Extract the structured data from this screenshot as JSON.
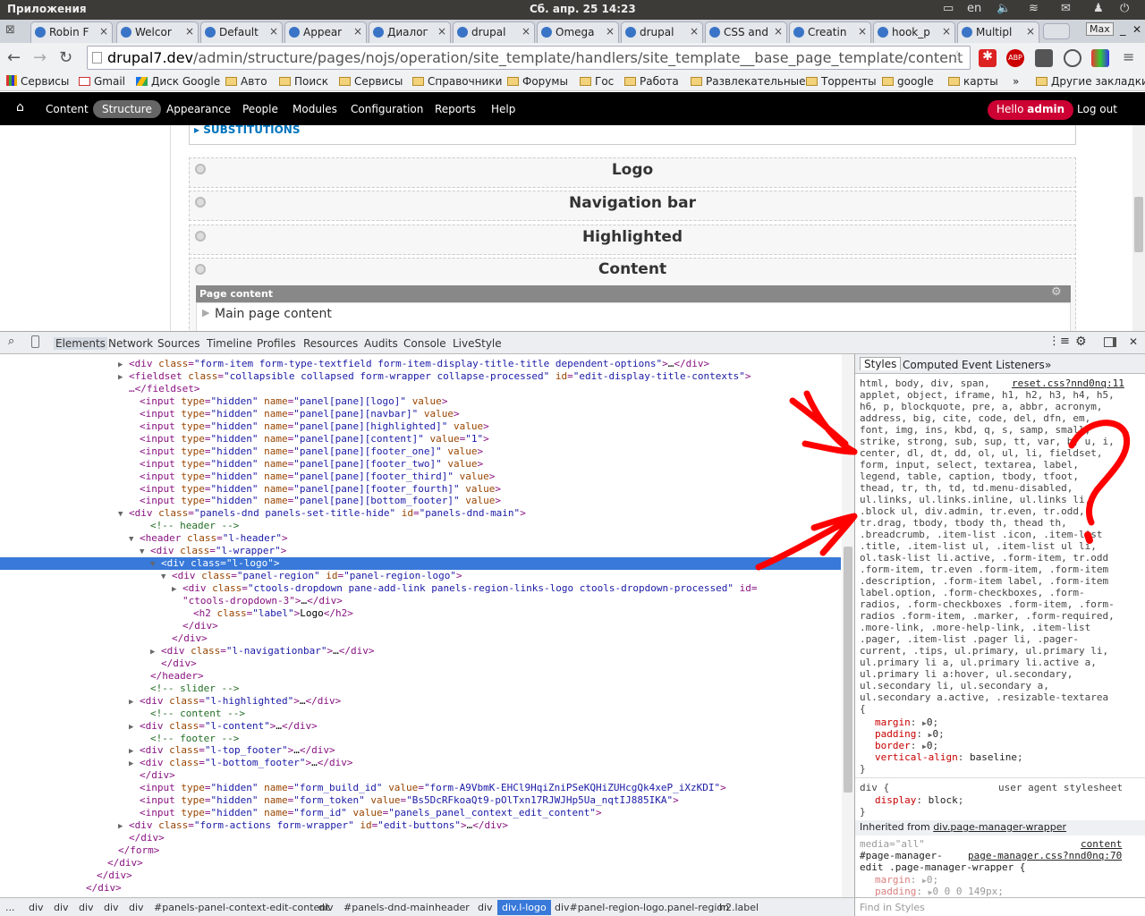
{
  "system": {
    "apps": "Приложения",
    "clock": "Сб. апр. 25 14:23",
    "lang": "en",
    "user": "Max"
  },
  "tabs": [
    "Robin F",
    "Welcor",
    "Default",
    "Appear",
    "Диалог",
    "drupal",
    "Omega",
    "drupal",
    "CSS and",
    "Creatin",
    "hook_p",
    "Multipl"
  ],
  "address": {
    "host": "drupal7.dev",
    "path": "/admin/structure/pages/nojs/operation/site_template/handlers/site_template__base_page_template/content"
  },
  "bookmarks": {
    "apps": "Сервисы",
    "items": [
      "Gmail",
      "Диск Google",
      "Авто",
      "Поиск",
      "Сервисы",
      "Справочники",
      "Форумы",
      "Гос",
      "Работа",
      "Развлекательные",
      "Торренты",
      "google",
      "карты"
    ],
    "more": "»",
    "other": "Другие закладки"
  },
  "admin_menu": {
    "items": [
      "Content",
      "Structure",
      "Appearance",
      "People",
      "Modules",
      "Configuration",
      "Reports",
      "Help"
    ],
    "active": "Structure",
    "hello": "Hello",
    "user": "admin",
    "logout": "Log out"
  },
  "page": {
    "substitutions": "SUBSTITUTIONS",
    "regions": [
      "Logo",
      "Navigation bar",
      "Highlighted",
      "Content"
    ],
    "pane_title": "Page content",
    "pane_item": "Main page content"
  },
  "devtools": {
    "tabs": [
      "Elements",
      "Network",
      "Sources",
      "Timeline",
      "Profiles",
      "Resources",
      "Audits",
      "Console",
      "LiveStyle"
    ],
    "active_tab": "Elements",
    "style_tabs": [
      "Styles",
      "Computed",
      "Event Listeners"
    ],
    "style_more": "»",
    "dom_lines": [
      {
        "i": 12,
        "t": "▶",
        "s": "<div class=\"form-item form-type-textfield form-item-display-title-title dependent-options\">…</div>"
      },
      {
        "i": 12,
        "t": "▶",
        "s": "<fieldset class=\"collapsible collapsed form-wrapper collapse-processed\" id=\"edit-display-title-contexts\">"
      },
      {
        "i": 12,
        "t": "",
        "s": "…</fieldset>"
      },
      {
        "i": 13,
        "t": "",
        "s": "<input type=\"hidden\" name=\"panel[pane][logo]\" value>"
      },
      {
        "i": 13,
        "t": "",
        "s": "<input type=\"hidden\" name=\"panel[pane][navbar]\" value>"
      },
      {
        "i": 13,
        "t": "",
        "s": "<input type=\"hidden\" name=\"panel[pane][highlighted]\" value>"
      },
      {
        "i": 13,
        "t": "",
        "s": "<input type=\"hidden\" name=\"panel[pane][content]\" value=\"1\">"
      },
      {
        "i": 13,
        "t": "",
        "s": "<input type=\"hidden\" name=\"panel[pane][footer_one]\" value>"
      },
      {
        "i": 13,
        "t": "",
        "s": "<input type=\"hidden\" name=\"panel[pane][footer_two]\" value>"
      },
      {
        "i": 13,
        "t": "",
        "s": "<input type=\"hidden\" name=\"panel[pane][footer_third]\" value>"
      },
      {
        "i": 13,
        "t": "",
        "s": "<input type=\"hidden\" name=\"panel[pane][footer_fourth]\" value>"
      },
      {
        "i": 13,
        "t": "",
        "s": "<input type=\"hidden\" name=\"panel[pane][bottom_footer]\" value>"
      },
      {
        "i": 12,
        "t": "▼",
        "s": "<div class=\"panels-dnd panels-set-title-hide\" id=\"panels-dnd-main\">"
      },
      {
        "i": 14,
        "t": "",
        "s": "<!-- header -->"
      },
      {
        "i": 13,
        "t": "▼",
        "s": "<header class=\"l-header\">"
      },
      {
        "i": 14,
        "t": "▼",
        "s": "<div class=\"l-wrapper\">"
      },
      {
        "i": 15,
        "t": "▼",
        "s": "<div class=\"l-logo\">"
      },
      {
        "i": 16,
        "t": "▼",
        "s": "<div class=\"panel-region\" id=\"panel-region-logo\">"
      },
      {
        "i": 17,
        "t": "▶",
        "s": "<div class=\"ctools-dropdown pane-add-link panels-region-links-logo ctools-dropdown-processed\" id="
      },
      {
        "i": 17,
        "t": "",
        "s": "\"ctools-dropdown-3\">…</div>"
      },
      {
        "i": 18,
        "t": "",
        "s": "<h2 class=\"label\">Logo</h2>"
      },
      {
        "i": 17,
        "t": "",
        "s": "</div>"
      },
      {
        "i": 16,
        "t": "",
        "s": "</div>"
      },
      {
        "i": 15,
        "t": "▶",
        "s": "<div class=\"l-navigationbar\">…</div>"
      },
      {
        "i": 15,
        "t": "",
        "s": "</div>"
      },
      {
        "i": 14,
        "t": "",
        "s": "</header>"
      },
      {
        "i": 14,
        "t": "",
        "s": "<!-- slider -->"
      },
      {
        "i": 13,
        "t": "▶",
        "s": "<div class=\"l-highlighted\">…</div>"
      },
      {
        "i": 14,
        "t": "",
        "s": "<!-- content -->"
      },
      {
        "i": 13,
        "t": "▶",
        "s": "<div class=\"l-content\">…</div>"
      },
      {
        "i": 14,
        "t": "",
        "s": "<!-- footer -->"
      },
      {
        "i": 13,
        "t": "▶",
        "s": "<div class=\"l-top_footer\">…</div>"
      },
      {
        "i": 13,
        "t": "▶",
        "s": "<div class=\"l-bottom_footer\">…</div>"
      },
      {
        "i": 13,
        "t": "",
        "s": "</div>"
      },
      {
        "i": 13,
        "t": "",
        "s": "<input type=\"hidden\" name=\"form_build_id\" value=\"form-A9VbmK-EHCl9HqiZniPSeKQHiZUHcgQk4xeP_iXzKDI\">"
      },
      {
        "i": 13,
        "t": "",
        "s": "<input type=\"hidden\" name=\"form_token\" value=\"Bs5DcRFkoaQt9-pOlTxn17RJWJHp5Ua_nqtIJ885IKA\">"
      },
      {
        "i": 13,
        "t": "",
        "s": "<input type=\"hidden\" name=\"form_id\" value=\"panels_panel_context_edit_content\">"
      },
      {
        "i": 12,
        "t": "▶",
        "s": "<div class=\"form-actions form-wrapper\" id=\"edit-buttons\">…</div>"
      },
      {
        "i": 12,
        "t": "",
        "s": "</div>"
      },
      {
        "i": 11,
        "t": "",
        "s": "</form>"
      },
      {
        "i": 10,
        "t": "",
        "s": "</div>"
      },
      {
        "i": 9,
        "t": "",
        "s": "</div>"
      },
      {
        "i": 8,
        "t": "",
        "s": "</div>"
      }
    ],
    "selected_line": 16,
    "reset_selector_lines": [
      "html, body, div, span,",
      "applet, object, iframe, h1, h2, h3, h4, h5,",
      "h6, p, blockquote, pre, a, abbr, acronym,",
      "address, big, cite, code, del, dfn, em,",
      "font, img, ins, kbd, q, s, samp, small,",
      "strike, strong, sub, sup, tt, var, b, u, i,",
      "center, dl, dt, dd, ol, ul, li, fieldset,",
      "form, input, select, textarea, label,",
      "legend, table, caption, tbody, tfoot,",
      "thead, tr, th, td, td.menu-disabled,",
      "ul.links, ul.links.inline, ul.links li,",
      ".block ul, div.admin, tr.even, tr.odd,",
      "tr.drag, tbody, tbody th, thead th,",
      ".breadcrumb, .item-list .icon, .item-list",
      ".title, .item-list ul, .item-list ul li,",
      "ol.task-list li.active, .form-item, tr.odd",
      ".form-item, tr.even .form-item, .form-item",
      ".description, .form-item label, .form-item",
      "label.option, .form-checkboxes, .form-",
      "radios, .form-checkboxes .form-item, .form-",
      "radios .form-item, .marker, .form-required,",
      ".more-link, .more-help-link, .item-list",
      ".pager, .item-list .pager li, .pager-",
      "current, .tips, ul.primary, ul.primary li,",
      "ul.primary li a, ul.primary li.active a,",
      "ul.primary li a:hover, ul.secondary,",
      "ul.secondary li, ul.secondary a,",
      "ul.secondary a.active, .resizable-textarea"
    ],
    "reset_source": "reset.css?nnd0nq:11",
    "reset_props": [
      {
        "name": "margin",
        "value": "0"
      },
      {
        "name": "padding",
        "value": "0"
      },
      {
        "name": "border",
        "value": "0"
      },
      {
        "name": "vertical-align",
        "value": "baseline"
      }
    ],
    "ua_rule": {
      "selector": "div {",
      "source": "user agent stylesheet",
      "prop": "display",
      "value": "block"
    },
    "inherited_label": "Inherited from",
    "inherited_from": "div.page-manager-wrapper",
    "media": "media=\"all\"",
    "media_link": "content",
    "pm_selector1": "#page-manager-",
    "pm_source": "page-manager.css?nnd0nq:70",
    "pm_selector2": "edit .page-manager-wrapper {",
    "pm_props": [
      {
        "name": "margin",
        "value": "0"
      },
      {
        "name": "padding",
        "value": "0 0 0 149px"
      }
    ],
    "find_styles": "Find in Styles",
    "breadcrumbs": [
      "...",
      "div",
      "div",
      "div",
      "div",
      "div",
      "#panels-panel-context-edit-content",
      "div",
      "#panels-dnd-main",
      "header",
      "div",
      "div.l-logo",
      "div#panel-region-logo.panel-region",
      "h2.label"
    ],
    "breadcrumb_active": "div.l-logo"
  },
  "colors": {
    "accent": "#3879d9",
    "annotation": "#ff0000",
    "drupal_hello": "#cc0033"
  }
}
